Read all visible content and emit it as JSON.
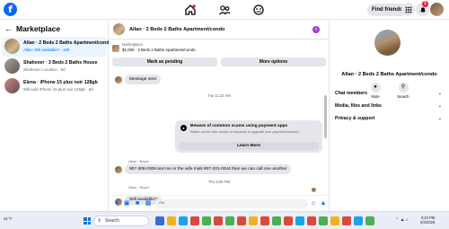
{
  "topbar": {
    "logo": "f",
    "find_friends": "Find friends",
    "notification_count": "1"
  },
  "left": {
    "title": "Marketplace",
    "conversations": [
      {
        "title": "Allan · 2 Beds 2 Baths Apartment/condo",
        "subtitle": "Allan: Still available? · 10h"
      },
      {
        "title": "Shahveer · 3 Beds 2 Baths House",
        "subtitle": "Shahveer: Location · 5d"
      },
      {
        "title": "Elena · iPhone 15 plus noir 128gb",
        "subtitle": "Will-sold iPhone 15 plus noir 128gb · 6d"
      }
    ]
  },
  "chat": {
    "header_name": "Allan · 2 Beds 2 Baths Apartment/condo",
    "listing_caption": "Marketplace",
    "listing_price": "$1,000 · 2 Beds 2 Baths Apartment/condo",
    "mark_pending": "Mark as pending",
    "more_options": "More options",
    "message_sent": "Message sent",
    "ts1": "Tue 11:23 AM",
    "scam_title": "Beware of common scams using payment apps",
    "scam_body": "Watch out for fake emails or requests to upgrade your payment account.",
    "learn_more": "Learn More",
    "sender1": "Allan · Buyer",
    "msg1": "907-308-0306 text me or the wife misti 907-201-0044 then we can call one another",
    "ts2": "Thu 9:08 PM",
    "sender2": "Allan · Buyer",
    "msg2": "Still available?",
    "input_placeholder": "Aa"
  },
  "right": {
    "name": "Allan · 2 Beds 2 Baths Apartment/condo",
    "mute": "Mute",
    "search": "Search",
    "rows": [
      "Chat members",
      "Media, files and links",
      "Privacy & support"
    ]
  },
  "taskbar": {
    "weather": "61°F",
    "search": "Search",
    "time": "3:24 PM",
    "date": "4/3/2025"
  },
  "colors": {
    "accent": "#0866ff",
    "bubble": "#e4e6eb",
    "badge": "#e41e3f"
  }
}
